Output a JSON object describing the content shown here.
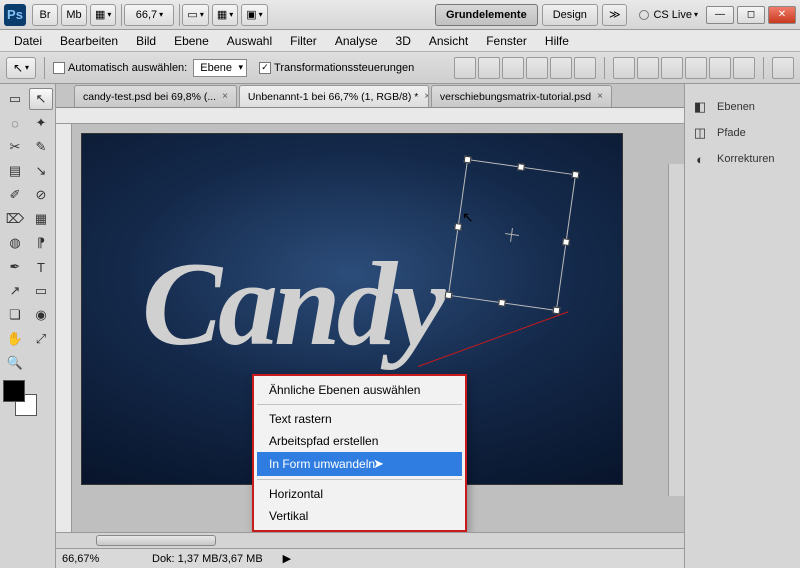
{
  "title": {
    "zoom": "66,7",
    "workspace_active": "Grundelemente",
    "workspace_other": "Design",
    "cslive": "CS Live",
    "br": "Br",
    "mb": "Mb"
  },
  "menu": [
    "Datei",
    "Bearbeiten",
    "Bild",
    "Ebene",
    "Auswahl",
    "Filter",
    "Analyse",
    "3D",
    "Ansicht",
    "Fenster",
    "Hilfe"
  ],
  "options": {
    "auto_select_label": "Automatisch auswählen:",
    "auto_select_target": "Ebene",
    "transform_controls_label": "Transformationssteuerungen",
    "transform_controls_checked": true
  },
  "tabs": [
    {
      "label": "candy-test.psd bei 69,8% (...",
      "active": false
    },
    {
      "label": "Unbenannt-1 bei 66,7% (1, RGB/8) *",
      "active": true
    },
    {
      "label": "verschiebungsmatrix-tutorial.psd",
      "active": false
    }
  ],
  "canvas_text": "Candy",
  "context_menu": {
    "items_top": [
      "Ähnliche Ebenen auswählen"
    ],
    "items_mid": [
      "Text rastern",
      "Arbeitspfad erstellen",
      "In Form umwandeln"
    ],
    "items_bot": [
      "Horizontal",
      "Vertikal"
    ],
    "highlighted": "In Form umwandeln"
  },
  "right_panels": [
    {
      "icon": "◧",
      "label": "Ebenen"
    },
    {
      "icon": "◫",
      "label": "Pfade"
    },
    {
      "icon": "◐",
      "label": "Korrekturen"
    }
  ],
  "status": {
    "zoom": "66,67%",
    "doc_info": "Dok: 1,37 MB/3,67 MB"
  },
  "tool_icons": [
    "▭",
    "↖",
    "◌",
    "✦",
    "✂",
    "✎",
    "▤",
    "↘",
    "✐",
    "⊘",
    "⌦",
    "▦",
    "◍",
    "⁋",
    "❏",
    "◉",
    "✒",
    "T",
    "↗",
    "▭",
    "✋",
    "⤢",
    "⊕",
    "🔍"
  ]
}
